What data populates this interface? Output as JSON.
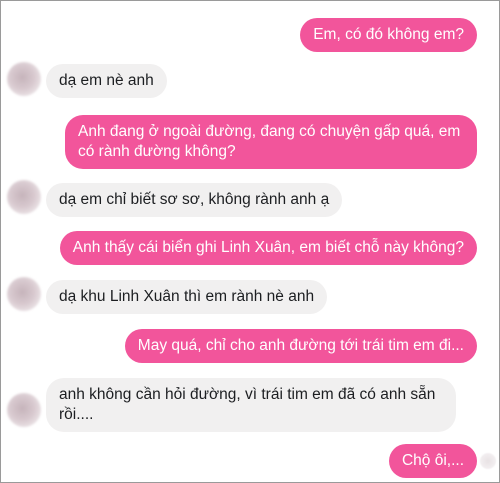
{
  "conversation": {
    "messages": [
      {
        "side": "outgoing",
        "text": "Em, có đó không em?"
      },
      {
        "side": "incoming",
        "text": "dạ em nè anh"
      },
      {
        "side": "outgoing",
        "text": "Anh đang ở ngoài đường, đang có chuyện gấp quá, em có rành đường không?"
      },
      {
        "side": "incoming",
        "text": "dạ em chỉ biết sơ sơ, không rành anh ạ"
      },
      {
        "side": "outgoing",
        "text": "Anh thấy cái biển ghi Linh Xuân, em biết chỗ này không?"
      },
      {
        "side": "incoming",
        "text": "dạ khu Linh Xuân thì em rành nè anh"
      },
      {
        "side": "outgoing",
        "text": "May quá, chỉ cho anh đường tới trái tim em đi..."
      },
      {
        "side": "incoming",
        "text": "anh không cần hỏi đường, vì trái tim em đã có anh sẵn rồi...."
      },
      {
        "side": "outgoing",
        "text": "Chộ ôi,..."
      }
    ]
  },
  "colors": {
    "outgoing_bubble": "#f2559b",
    "incoming_bubble": "#f1f0f0"
  },
  "icons": {
    "contact_avatar": "blurred-avatar-icon",
    "read_receipt": "read-receipt-icon"
  }
}
